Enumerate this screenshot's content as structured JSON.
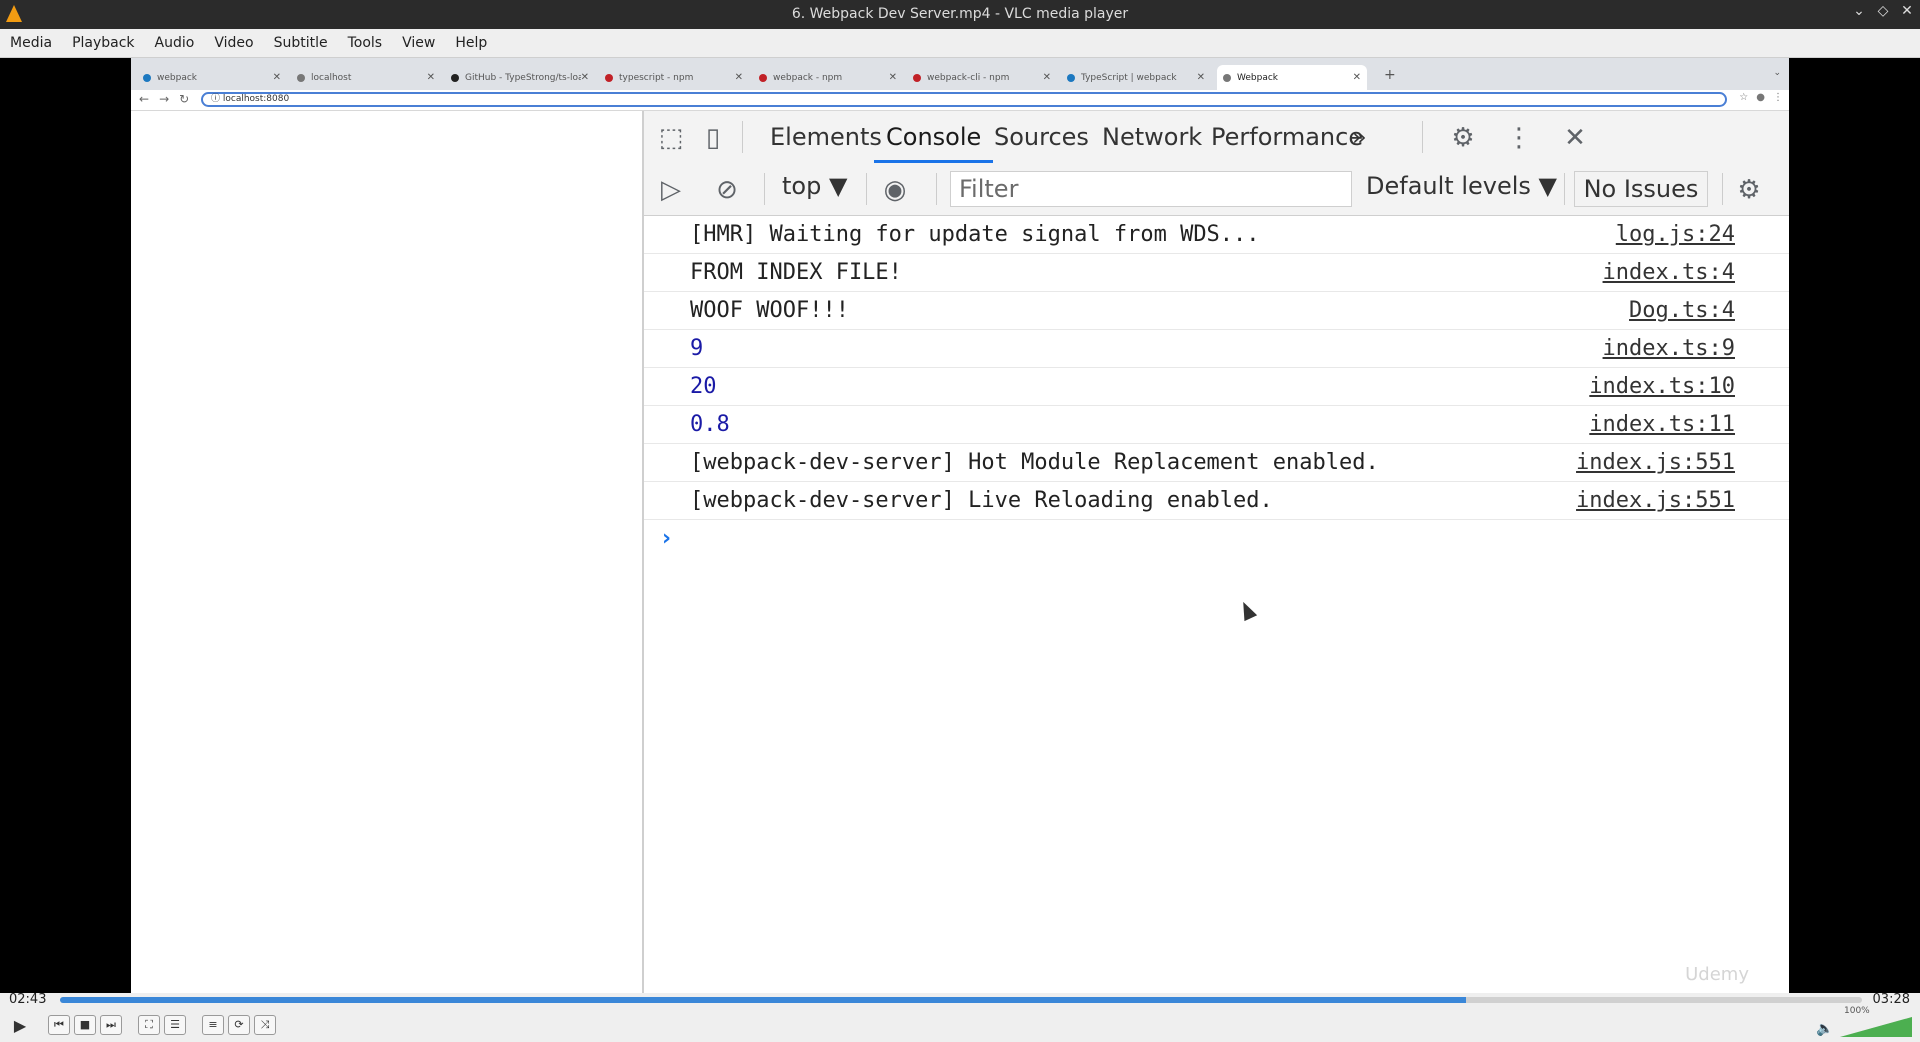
{
  "window": {
    "title": "6. Webpack Dev Server.mp4 - VLC media player"
  },
  "menu": [
    "Media",
    "Playback",
    "Audio",
    "Video",
    "Subtitle",
    "Tools",
    "View",
    "Help"
  ],
  "browser": {
    "tabs": [
      {
        "label": "webpack",
        "color": "#1c78c0"
      },
      {
        "label": "localhost",
        "color": "#777777"
      },
      {
        "label": "GitHub - TypeStrong/ts-loader",
        "color": "#222222"
      },
      {
        "label": "typescript - npm",
        "color": "#c12127"
      },
      {
        "label": "webpack - npm",
        "color": "#c12127"
      },
      {
        "label": "webpack-cli - npm",
        "color": "#c12127"
      },
      {
        "label": "TypeScript | webpack",
        "color": "#1c78c0"
      },
      {
        "label": "Webpack",
        "color": "#777777"
      }
    ],
    "url": "localhost:8080"
  },
  "devtools": {
    "tabs": [
      "Elements",
      "Console",
      "Sources",
      "Network",
      "Performance"
    ],
    "active_tab": "Console",
    "more_tabs_label": "»",
    "context": "top ▼",
    "filter_placeholder": "Filter",
    "levels": "Default levels ▼",
    "issues": "No Issues",
    "console_rows": [
      {
        "msg": "[HMR] Waiting for update signal from WDS...",
        "src": "log.js:24",
        "numeric": false
      },
      {
        "msg": "FROM INDEX FILE!",
        "src": "index.ts:4",
        "numeric": false
      },
      {
        "msg": "WOOF WOOF!!!",
        "src": "Dog.ts:4",
        "numeric": false
      },
      {
        "msg": "9",
        "src": "index.ts:9",
        "numeric": true
      },
      {
        "msg": "20",
        "src": "index.ts:10",
        "numeric": true
      },
      {
        "msg": "0.8",
        "src": "index.ts:11",
        "numeric": true
      },
      {
        "msg": "[webpack-dev-server] Hot Module Replacement enabled.",
        "src": "index.js:551",
        "numeric": false
      },
      {
        "msg": "[webpack-dev-server] Live Reloading enabled.",
        "src": "index.js:551",
        "numeric": false
      }
    ],
    "prompt": "›",
    "watermark": "Udemy"
  },
  "player": {
    "elapsed": "02:43",
    "total": "03:28",
    "progress": 0.78,
    "volume_label": "100%",
    "volume": 1.0
  }
}
